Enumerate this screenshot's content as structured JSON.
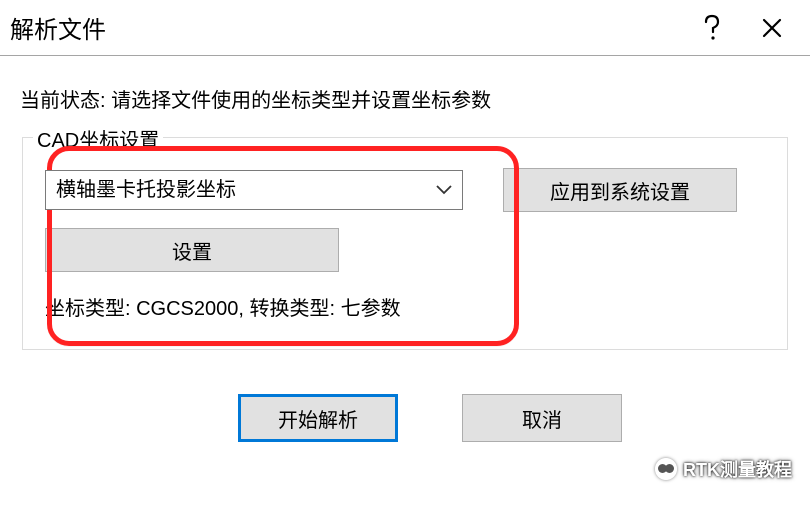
{
  "window": {
    "title": "解析文件"
  },
  "status": {
    "label": "当前状态:",
    "text": "请选择文件使用的坐标类型并设置坐标参数"
  },
  "group": {
    "label": "CAD坐标设置",
    "projection_select": {
      "value": "横轴墨卡托投影坐标"
    },
    "apply_button": "应用到系统设置",
    "settings_button": "设置",
    "coord_info": "坐标类型: CGCS2000, 转换类型: 七参数"
  },
  "buttons": {
    "start": "开始解析",
    "cancel": "取消"
  },
  "watermark": {
    "text": "RTK测量教程"
  }
}
